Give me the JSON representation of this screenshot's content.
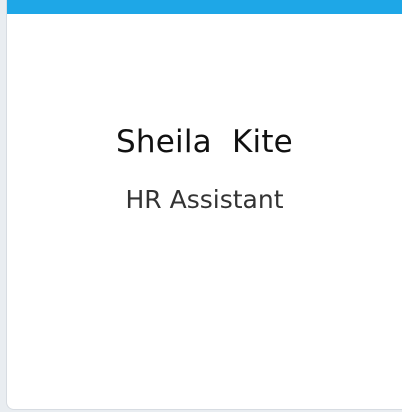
{
  "card": {
    "name": "Sheila  Kite",
    "job_title": "HR Assistant"
  },
  "colors": {
    "accent_bar": "#1EA7E7",
    "background": "#FFFFFF",
    "text_primary": "#111111",
    "text_secondary": "#333333"
  }
}
